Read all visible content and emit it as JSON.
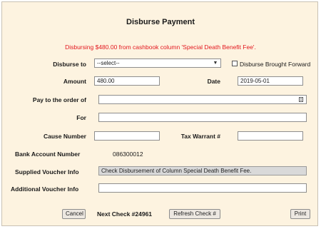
{
  "dialog": {
    "title": "Disburse Payment",
    "notice": "Disbursing $480.00 from cashbook column 'Special Death Benefit Fee'."
  },
  "form": {
    "disburse_to_label": "Disburse to",
    "disburse_to_value": "--select--",
    "brought_forward_label": "Disburse Brought Forward",
    "amount_label": "Amount",
    "amount_value": "480.00",
    "date_label": "Date",
    "date_value": "2019-05-01",
    "pay_to_label": "Pay to the order of",
    "pay_to_value": "",
    "for_label": "For",
    "for_value": "",
    "cause_label": "Cause Number",
    "cause_value": "",
    "tax_warrant_label": "Tax Warrant #",
    "tax_warrant_value": "",
    "bank_label": "Bank Account Number",
    "bank_value": "086300012",
    "supplied_label": "Supplied Voucher Info",
    "supplied_value": "Check Disbursement of Column Special  Death  Benefit  Fee.",
    "additional_label": "Additional Voucher Info",
    "additional_value": ""
  },
  "footer": {
    "cancel_label": "Cancel",
    "next_check": "Next Check #24961",
    "refresh_label": "Refresh Check #",
    "print_label": "Print"
  }
}
